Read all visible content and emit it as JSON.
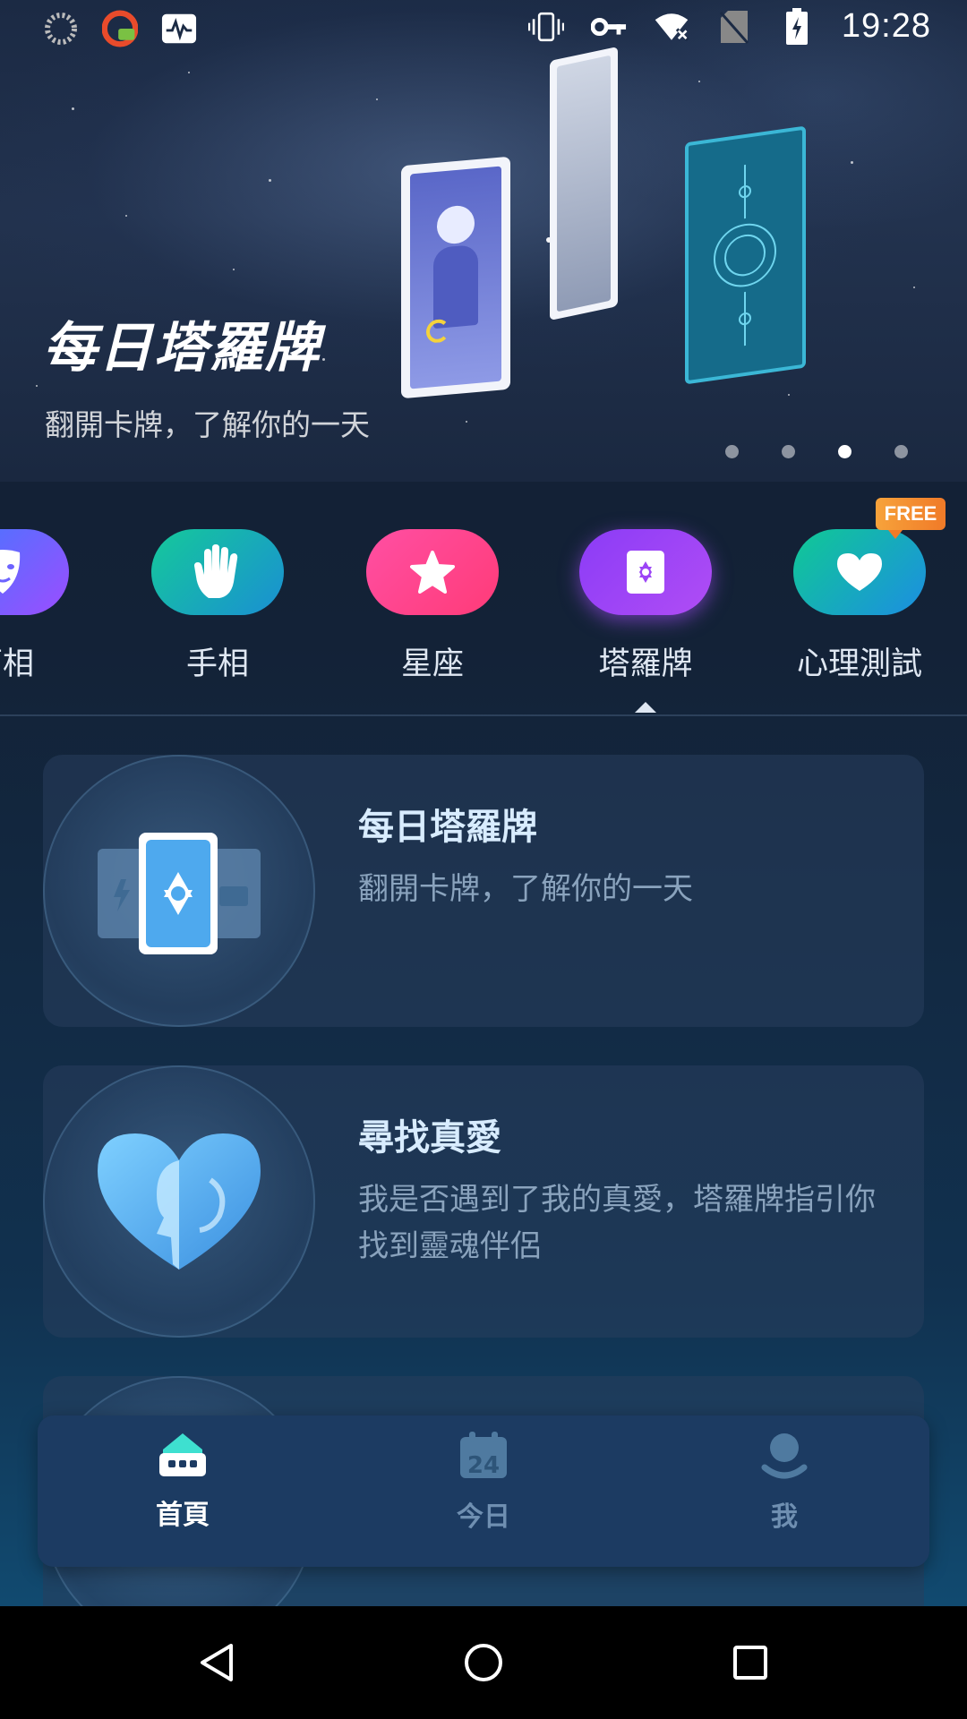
{
  "status_bar": {
    "time": "19:28",
    "left_icons": [
      "loading-circle-icon",
      "vpn-app-icon",
      "activity-monitor-icon"
    ],
    "right_icons": [
      "vibrate-icon",
      "key-icon",
      "wifi-off-icon",
      "no-sim-icon",
      "battery-charging-icon"
    ]
  },
  "banner": {
    "title": "每日塔羅牌",
    "subtitle": "翻開卡牌，了解你的一天",
    "page_count": 4,
    "active_page": 3
  },
  "categories": [
    {
      "label": "面相",
      "icon": "face-icon"
    },
    {
      "label": "手相",
      "icon": "hand-icon"
    },
    {
      "label": "星座",
      "icon": "star-icon"
    },
    {
      "label": "塔羅牌",
      "icon": "tarot-card-icon",
      "selected": true
    },
    {
      "label": "心理測試",
      "icon": "heart-icon",
      "badge": "FREE"
    }
  ],
  "cards": [
    {
      "title": "每日塔羅牌",
      "description": "翻開卡牌，了解你的一天",
      "icon": "tarot-cards-illustration-icon"
    },
    {
      "title": "尋找真愛",
      "description": "我是否遇到了我的真愛，塔羅牌指引你找到靈魂伴侶",
      "icon": "heart-profile-illustration-icon"
    }
  ],
  "bottom_nav": [
    {
      "label": "首頁",
      "icon": "home-icon",
      "active": true
    },
    {
      "label": "今日",
      "icon": "calendar-icon",
      "calendar_day": "24"
    },
    {
      "label": "我",
      "icon": "user-icon"
    }
  ],
  "colors": {
    "accent_purple": "#a142f4",
    "accent_pink": "#ff4fa3",
    "accent_green": "#17c39a",
    "free_badge": "#f39130"
  }
}
